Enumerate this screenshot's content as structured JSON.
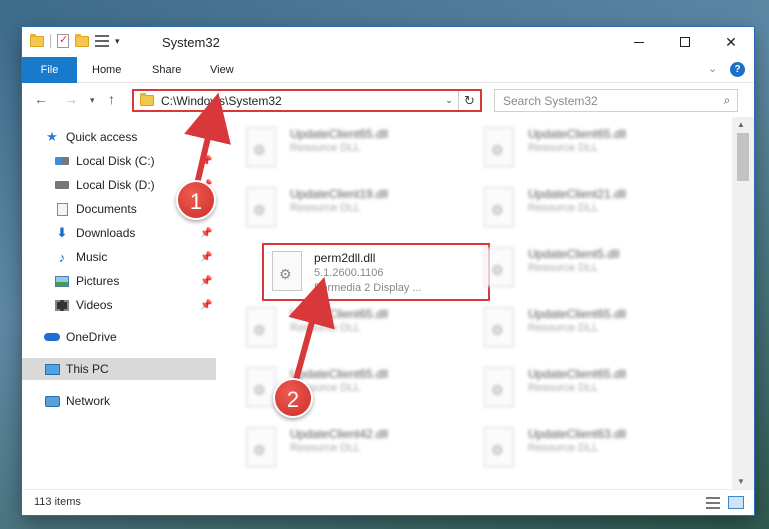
{
  "window": {
    "title": "System32"
  },
  "ribbon": {
    "tabs": [
      "File",
      "Home",
      "Share",
      "View"
    ]
  },
  "nav": {
    "address": "C:\\Windows\\System32",
    "search_placeholder": "Search System32"
  },
  "sidebar": {
    "items": [
      {
        "label": "Quick access",
        "icon": "star-icon",
        "pinned": false
      },
      {
        "label": "Local Disk (C:)",
        "icon": "drive-icon",
        "pinned": true
      },
      {
        "label": "Local Disk (D:)",
        "icon": "drive-icon",
        "pinned": true
      },
      {
        "label": "Documents",
        "icon": "documents-icon",
        "pinned": true
      },
      {
        "label": "Downloads",
        "icon": "download-icon",
        "pinned": true
      },
      {
        "label": "Music",
        "icon": "music-icon",
        "pinned": true
      },
      {
        "label": "Pictures",
        "icon": "pictures-icon",
        "pinned": true
      },
      {
        "label": "Videos",
        "icon": "videos-icon",
        "pinned": true
      },
      {
        "label": "OneDrive",
        "icon": "cloud-icon",
        "pinned": false
      },
      {
        "label": "This PC",
        "icon": "computer-icon",
        "pinned": false,
        "selected": true
      },
      {
        "label": "Network",
        "icon": "network-icon",
        "pinned": false
      }
    ]
  },
  "files": [
    {
      "name": "UpdateClient65.dll",
      "type": "Resource DLL"
    },
    {
      "name": "UpdateClient65.dll",
      "type": "Resource DLL"
    },
    {
      "name": "UpdateClient19.dll",
      "type": "Resource DLL"
    },
    {
      "name": "UpdateClient21.dll",
      "type": "Resource DLL"
    },
    {
      "name": "perm2dll.dll",
      "version": "5.1.2600.1106",
      "type": "Permedia 2 Display ..."
    },
    {
      "name": "UpdateClient5.dll",
      "type": "Resource DLL"
    },
    {
      "name": "UpdateClient65.dll",
      "type": "Resource DLL"
    },
    {
      "name": "UpdateClient65.dll",
      "type": "Resource DLL"
    },
    {
      "name": "UpdateClient65.dll",
      "type": "Resource DLL"
    },
    {
      "name": "UpdateClient65.dll",
      "type": "Resource DLL"
    },
    {
      "name": "UpdateClient42.dll",
      "type": "Resource DLL"
    },
    {
      "name": "UpdateClient63.dll",
      "type": "Resource DLL"
    }
  ],
  "status": {
    "items": "113 items"
  },
  "annotations": {
    "step1": "1",
    "step2": "2",
    "color": "#d9383a"
  }
}
